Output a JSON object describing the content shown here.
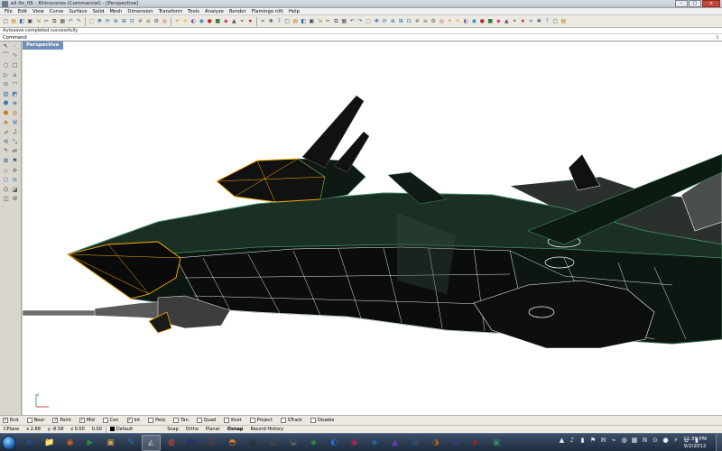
{
  "window": {
    "title": "ell-9x_06 - Rhinoceros (Commercial) - [Perspective]",
    "controls": {
      "minimize": "–",
      "maximize": "□",
      "close": "✕"
    }
  },
  "menu": [
    "File",
    "Edit",
    "View",
    "Curve",
    "Surface",
    "Solid",
    "Mesh",
    "Dimension",
    "Transform",
    "Tools",
    "Analyze",
    "Render",
    "Flamingo nXt",
    "Help"
  ],
  "toolbar_icons": [
    "new",
    "open",
    "save",
    "print",
    "import",
    "cut",
    "copy",
    "paste",
    "undo",
    "redo",
    "select",
    "pan",
    "rotate",
    "zoom",
    "zoom-window",
    "zoom-extents",
    "grid",
    "layers",
    "properties",
    "osnap",
    "light",
    "bulb",
    "shade",
    "render",
    "sphere",
    "cube",
    "color",
    "material",
    "camera",
    "record",
    "mesh",
    "settings",
    "help",
    "extra1",
    "extra2",
    "extra3",
    "extra4",
    "extra5",
    "extra6",
    "extra7",
    "extra8",
    "extra9",
    "extra10",
    "extra11",
    "extra12",
    "extra13",
    "extra14",
    "extra15",
    "extra16",
    "extra17",
    "extra18",
    "extra19",
    "extra20",
    "extra21",
    "extra22",
    "extra23",
    "extra24",
    "extra25",
    "extra26",
    "extra27",
    "extra28",
    "extra29",
    "extra30",
    "extra31",
    "extra32",
    "extra33",
    "extra34",
    "extra35"
  ],
  "status_message": "Autosave completed successfully",
  "command": {
    "label": "Command",
    "scroll": "⇕"
  },
  "viewport": {
    "tab": "Perspective",
    "wire_color": "#ffffff",
    "highlight_color": "#ffb000",
    "body_color": "#0d1410",
    "hull_green": "#1b3024"
  },
  "osnaps": [
    {
      "label": "End",
      "checked": true
    },
    {
      "label": "Near",
      "checked": false
    },
    {
      "label": "Point",
      "checked": true
    },
    {
      "label": "Mid",
      "checked": true
    },
    {
      "label": "Cen",
      "checked": false
    },
    {
      "label": "Int",
      "checked": true
    },
    {
      "label": "Perp",
      "checked": false
    },
    {
      "label": "Tan",
      "checked": false
    },
    {
      "label": "Quad",
      "checked": false
    },
    {
      "label": "Knot",
      "checked": false
    },
    {
      "label": "Project",
      "checked": false
    },
    {
      "label": "STrack",
      "checked": false
    },
    {
      "label": "Disable",
      "checked": false
    }
  ],
  "statusbar": {
    "cplane": "CPlane",
    "x": "x 2.88",
    "y": "y -6.58",
    "z": "z 0.00",
    "extra": "0.00",
    "layer": "Default",
    "modes": [
      "Snap",
      "Ortho",
      "Planar",
      "Osnap",
      "Record History"
    ]
  },
  "taskbar": {
    "apps": [
      "ie",
      "explorer",
      "firefox",
      "media",
      "folder",
      "notepad",
      "rhino",
      "chrome",
      "ps",
      "zbrush",
      "blender",
      "steam",
      "app13",
      "app14",
      "app15",
      "app16",
      "app17",
      "app18",
      "app19",
      "app20",
      "app21",
      "app22",
      "app23",
      "app24"
    ],
    "clock_time": "11:39 PM",
    "clock_date": "9/2/2012"
  }
}
